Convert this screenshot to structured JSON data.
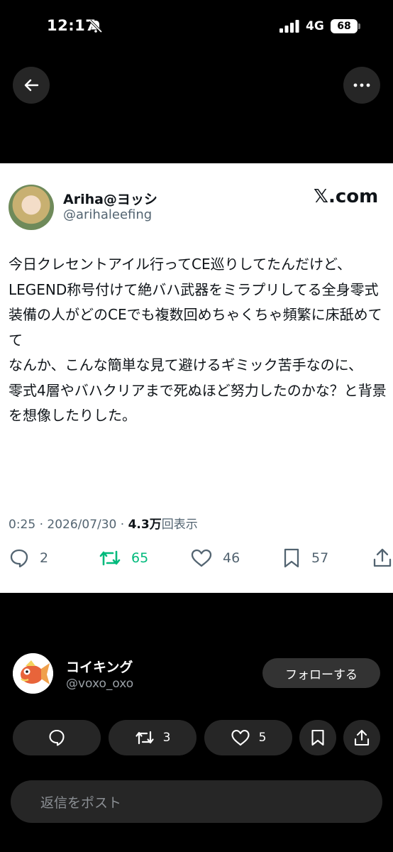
{
  "status_bar": {
    "time": "12:17",
    "network": "4G",
    "battery": "68"
  },
  "tweet": {
    "author_name": "Ariha@ヨッシ",
    "author_handle": "@arihaleefing",
    "brand": "𝕏.com",
    "text": "今日クレセントアイル行ってCE巡りしてたんだけど、\nLEGEND称号付けて絶バハ武器をミラプリしてる全身零式装備の人がどのCEでも複数回めちゃくちゃ頻繁に床舐めてて\nなんか、こんな簡単な見て避けるギミック苦手なのに、\n零式4層やバハクリアまで死ぬほど努力したのかな？と背景を想像したりした。",
    "meta_time": "0:25 · 2026/07/30 · ",
    "meta_views": "4.3万",
    "meta_views_suffix": "回表示",
    "replies": "2",
    "retweets": "65",
    "likes": "46",
    "bookmarks": "57"
  },
  "poster": {
    "name": "コイキング",
    "handle": "@voxo_oxo",
    "follow_label": "フォローする"
  },
  "actions": {
    "retweets": "3",
    "likes": "5"
  },
  "reply_box": {
    "placeholder": "返信をポスト"
  },
  "colors": {
    "retweet_green": "#00ba7c",
    "card_bg": "#ffffff",
    "page_bg": "#000000"
  }
}
